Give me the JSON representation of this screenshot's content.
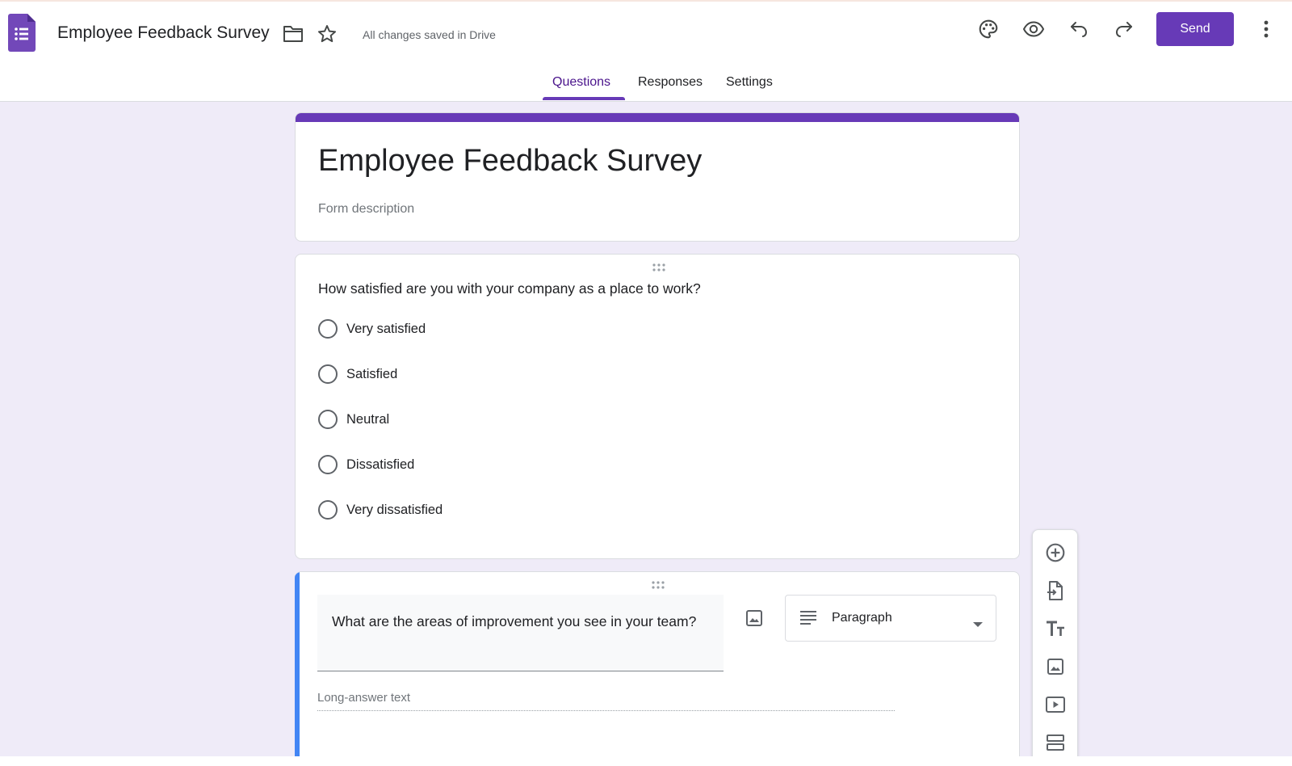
{
  "header": {
    "doc_title": "Employee Feedback Survey",
    "save_status": "All changes saved in Drive",
    "send_label": "Send",
    "icons": [
      "forms-logo-icon",
      "folder-icon",
      "star-icon",
      "palette-icon",
      "preview-eye-icon",
      "undo-icon",
      "redo-icon",
      "more-vert-icon"
    ]
  },
  "tabs": [
    {
      "label": "Questions",
      "active": true
    },
    {
      "label": "Responses",
      "active": false
    },
    {
      "label": "Settings",
      "active": false
    }
  ],
  "form": {
    "title": "Employee Feedback Survey",
    "description_placeholder": "Form description"
  },
  "questions": [
    {
      "text": "How satisfied are you with your company as a place to work?",
      "type": "Multiple choice",
      "options": [
        "Very satisfied",
        "Satisfied",
        "Neutral",
        "Dissatisfied",
        "Very dissatisfied"
      ]
    },
    {
      "text": "What are the areas of improvement you see in your team?",
      "type_label": "Paragraph",
      "answer_placeholder": "Long-answer text"
    }
  ],
  "toolbar": {
    "items": [
      "add-question-icon",
      "import-questions-icon",
      "add-title-icon",
      "add-image-icon",
      "add-video-icon",
      "add-section-icon"
    ]
  },
  "colors": {
    "accent": "#673ab7",
    "active_tab_text": "#4a148c",
    "background": "#efebf8",
    "focus_bar": "#4285f4"
  }
}
